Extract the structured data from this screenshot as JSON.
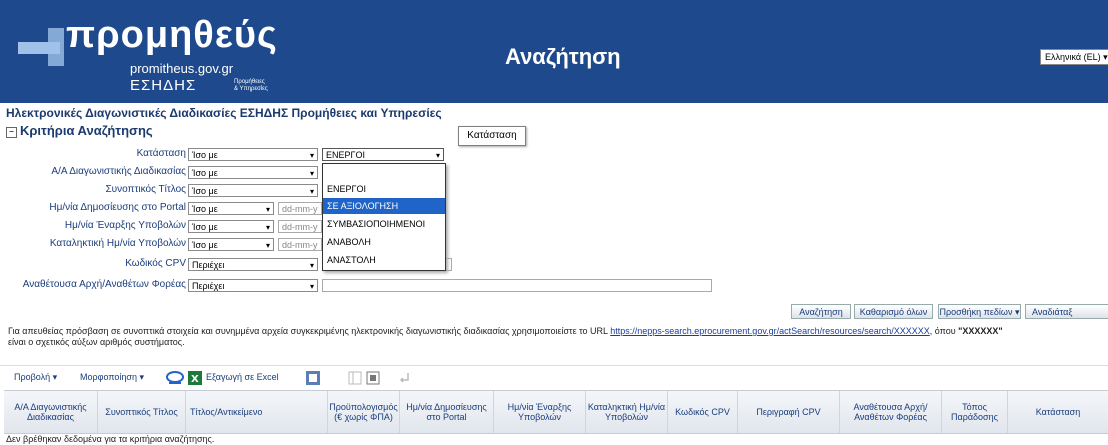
{
  "header": {
    "logo_main": "προμηθεύς",
    "logo_url": "promitheus.gov.gr",
    "logo_esidis": "ΕΣΗΔΗΣ",
    "logo_esidis_small1": "Προμήθειες",
    "logo_esidis_small2": "& Υπηρεσίες",
    "title": "Αναζήτηση",
    "language": "Ελληνικά (EL)"
  },
  "page": {
    "main_title": "Ηλεκτρονικές Διαγωνιστικές Διαδικασίες ΕΣΗΔΗΣ Προμήθειες και Υπηρεσίες",
    "criteria_title": "Κριτήρια Αναζήτησης",
    "tooltip": "Κατάσταση"
  },
  "criteria": [
    {
      "label": "Κατάσταση",
      "operator": "Ίσο με",
      "value": "ΕΝΕΡΓΟΙ"
    },
    {
      "label": "Α/Α Διαγωνιστικής Διαδικασίας",
      "operator": "Ίσο με",
      "value": ""
    },
    {
      "label": "Συνοπτικός Τίτλος",
      "operator": "Ίσο με",
      "value": ""
    },
    {
      "label": "Ημ/νία Δημοσίευσης στο Portal",
      "operator": "Ίσο με",
      "value": "dd-mm-y"
    },
    {
      "label": "Ημ/νία Έναρξης Υποβολών",
      "operator": "Ίσο με",
      "value": "dd-mm-y"
    },
    {
      "label": "Καταληκτική Ημ/νία Υποβολών",
      "operator": "Ίσο με",
      "value": "dd-mm-y"
    },
    {
      "label": "Κωδικός CPV",
      "operator": "Περιέχει",
      "value": ""
    },
    {
      "label": "Αναθέτουσα Αρχή/Αναθέτων Φορέας",
      "operator": "Περιέχει",
      "value": ""
    }
  ],
  "dropdown_options": [
    "",
    "ΕΝΕΡΓΟΙ",
    "ΣΕ ΑΞΙΟΛΟΓΗΣΗ",
    "ΣΥΜΒΑΣΙΟΠΟΙΗΜΕΝΟΙ",
    "ΑΝΑΒΟΛΗ",
    "ΑΝΑΣΤΟΛΗ"
  ],
  "buttons": {
    "search": "Αναζήτηση",
    "clear": "Καθαρισμό όλων",
    "add_fields": "Προσθήκη πεδίων",
    "saved": "Αναδιάταξ"
  },
  "info": {
    "text1": "Για απευθείας πρόσβαση σε συνοπτικά στοιχεία και συνημμένα αρχεία συγκεκριμένης ηλεκτρονικής διαγωνιστικής διαδικασίας χρησιμοποιείστε το URL ",
    "link": "https://nepps-search.eprocurement.gov.gr/actSearch/resources/search/XXXXXX",
    "text2": ", όπου ",
    "bold": "\"XXXXXX\"",
    "text3": "είναι ο σχετικός αύξων αριθμός συστήματος."
  },
  "toolbar": {
    "view": "Προβολή",
    "format": "Μορφοποίηση",
    "export": "Εξαγωγή σε Excel"
  },
  "columns": [
    "Α/Α Διαγωνιστικής Διαδικασίας",
    "Συνοπτικός Τίτλος",
    "Τίτλος/Αντικείμενο",
    "Προϋπολογισμός (€ χωρίς ΦΠΑ)",
    "Ημ/νία Δημοσίευσης στο Portal",
    "Ημ/νία Έναρξης Υποβολών",
    "Καταληκτική Ημ/νία Υποβολών",
    "Κωδικός CPV",
    "Περιγραφή CPV",
    "Αναθέτουσα Αρχή/ Αναθέτων Φορέας",
    "Τόπος Παράδοσης",
    "Κατάσταση"
  ],
  "no_data": "Δεν βρέθηκαν δεδομένα για τα κριτήρια αναζήτησης."
}
